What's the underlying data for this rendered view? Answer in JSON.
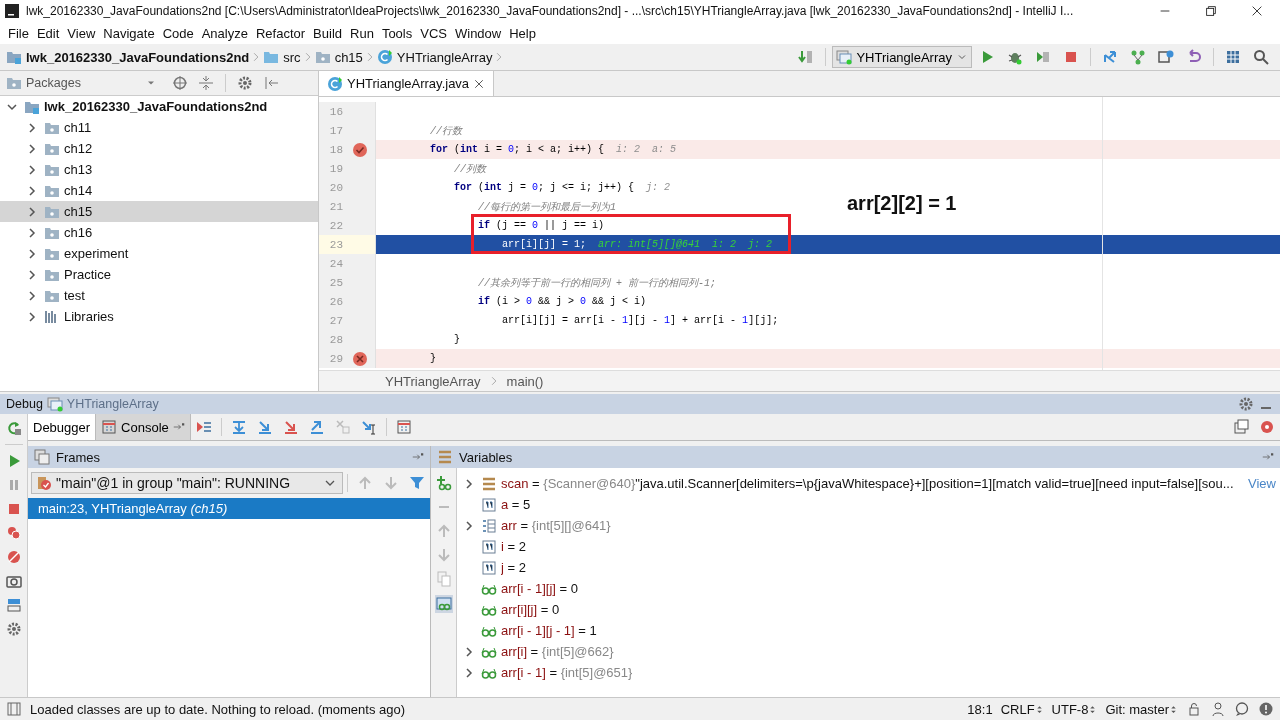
{
  "window": {
    "title": "lwk_20162330_JavaFoundations2nd [C:\\Users\\Administrator\\IdeaProjects\\lwk_20162330_JavaFoundations2nd] - ...\\src\\ch15\\YHTriangleArray.java [lwk_20162330_JavaFoundations2nd] - IntelliJ I..."
  },
  "menu": [
    "File",
    "Edit",
    "View",
    "Navigate",
    "Code",
    "Analyze",
    "Refactor",
    "Build",
    "Run",
    "Tools",
    "VCS",
    "Window",
    "Help"
  ],
  "breadcrumbs": [
    {
      "label": "lwk_20162330_JavaFoundations2nd",
      "kind": "project"
    },
    {
      "label": "src",
      "kind": "folder"
    },
    {
      "label": "ch15",
      "kind": "package"
    },
    {
      "label": "YHTriangleArray",
      "kind": "class"
    }
  ],
  "run_config": "YHTriangleArray",
  "project_panel": {
    "view": "Packages",
    "tree": [
      {
        "label": "lwk_20162330_JavaFoundations2nd",
        "kind": "module",
        "expanded": true,
        "selected": false,
        "children": [
          {
            "label": "ch11",
            "kind": "package",
            "expanded": false,
            "selected": false
          },
          {
            "label": "ch12",
            "kind": "package",
            "expanded": false,
            "selected": false
          },
          {
            "label": "ch13",
            "kind": "package",
            "expanded": false,
            "selected": false
          },
          {
            "label": "ch14",
            "kind": "package",
            "expanded": false,
            "selected": false
          },
          {
            "label": "ch15",
            "kind": "package",
            "expanded": false,
            "selected": true
          },
          {
            "label": "ch16",
            "kind": "package",
            "expanded": false,
            "selected": false
          },
          {
            "label": "experiment",
            "kind": "package",
            "expanded": false,
            "selected": false
          },
          {
            "label": "Practice",
            "kind": "package",
            "expanded": false,
            "selected": false
          },
          {
            "label": "test",
            "kind": "package",
            "expanded": false,
            "selected": false
          },
          {
            "label": "Libraries",
            "kind": "libraries",
            "expanded": false,
            "selected": false
          }
        ]
      }
    ]
  },
  "editor": {
    "tabs": [
      {
        "label": "YHTriangleArray.java",
        "selected": true
      }
    ],
    "lines": [
      {
        "number": "16",
        "kind": "plain",
        "current": false
      },
      {
        "number": "17",
        "kind": "plain",
        "current": false,
        "tokens": [
          {
            "t": "        //行数",
            "kind": "comment"
          }
        ]
      },
      {
        "number": "18",
        "kind": "breakpoint",
        "current": false,
        "tokens": [
          {
            "t": "        for",
            "kind": "keyword"
          },
          {
            "t": " (",
            "kind": "plain"
          },
          {
            "t": "int",
            "kind": "keyword"
          },
          {
            "t": " i = ",
            "kind": "plain"
          },
          {
            "t": "0",
            "kind": "number"
          },
          {
            "t": "; i < a; i++) {",
            "kind": "plain"
          },
          {
            "t": "  i: 2  a: 5",
            "kind": "hint"
          }
        ]
      },
      {
        "number": "19",
        "kind": "plain",
        "current": false,
        "tokens": [
          {
            "t": "            //列数",
            "kind": "comment"
          }
        ]
      },
      {
        "number": "20",
        "kind": "plain",
        "current": false,
        "tokens": [
          {
            "t": "            for",
            "kind": "keyword"
          },
          {
            "t": " (",
            "kind": "plain"
          },
          {
            "t": "int",
            "kind": "keyword"
          },
          {
            "t": " j = ",
            "kind": "plain"
          },
          {
            "t": "0",
            "kind": "number"
          },
          {
            "t": "; j <= i; j++) {",
            "kind": "plain"
          },
          {
            "t": "  j: 2",
            "kind": "hint"
          }
        ]
      },
      {
        "number": "21",
        "kind": "plain",
        "current": false,
        "tokens": [
          {
            "t": "                //每行的第一列和最后一列为1",
            "kind": "comment"
          }
        ]
      },
      {
        "number": "22",
        "kind": "plain",
        "current": false,
        "tokens": [
          {
            "t": "                if",
            "kind": "keyword"
          },
          {
            "t": " (j == ",
            "kind": "plain"
          },
          {
            "t": "0",
            "kind": "number"
          },
          {
            "t": " || j == i)",
            "kind": "plain"
          }
        ]
      },
      {
        "number": "23",
        "kind": "plain",
        "current": true,
        "tokens": [
          {
            "t": "                    arr[i][j] = 1;",
            "kind": "plain"
          },
          {
            "t": "  arr: int[5][]@641  i: 2  j: 2",
            "kind": "hint"
          }
        ]
      },
      {
        "number": "24",
        "kind": "plain",
        "current": false
      },
      {
        "number": "25",
        "kind": "plain",
        "current": false,
        "tokens": [
          {
            "t": "                //其余列等于前一行的相同列 + 前一行的相同列-1;",
            "kind": "comment"
          }
        ]
      },
      {
        "number": "26",
        "kind": "plain",
        "current": false,
        "tokens": [
          {
            "t": "                if",
            "kind": "keyword"
          },
          {
            "t": " (i > ",
            "kind": "plain"
          },
          {
            "t": "0",
            "kind": "number"
          },
          {
            "t": " && j > ",
            "kind": "plain"
          },
          {
            "t": "0",
            "kind": "number"
          },
          {
            "t": " && j < i)",
            "kind": "plain"
          }
        ]
      },
      {
        "number": "27",
        "kind": "plain",
        "current": false,
        "tokens": [
          {
            "t": "                    arr[i][j] = arr[i - ",
            "kind": "plain"
          },
          {
            "t": "1",
            "kind": "number"
          },
          {
            "t": "][j - ",
            "kind": "plain"
          },
          {
            "t": "1",
            "kind": "number"
          },
          {
            "t": "] + arr[i - ",
            "kind": "plain"
          },
          {
            "t": "1",
            "kind": "number"
          },
          {
            "t": "][j];",
            "kind": "plain"
          }
        ]
      },
      {
        "number": "28",
        "kind": "plain",
        "current": false,
        "tokens": [
          {
            "t": "            }",
            "kind": "plain"
          }
        ]
      },
      {
        "number": "29",
        "kind": "invalid_breakpoint",
        "current": false,
        "tokens": [
          {
            "t": "        }",
            "kind": "plain"
          }
        ]
      }
    ],
    "annotation": "arr[2][2] = 1",
    "breadcrumb": [
      "YHTriangleArray",
      "main()"
    ]
  },
  "debug": {
    "title": "Debug",
    "config": "YHTriangleArray",
    "tabs": [
      {
        "label": "Debugger",
        "selected": true
      },
      {
        "label": "Console",
        "selected": false
      }
    ],
    "frames": {
      "title": "Frames",
      "thread": "\"main\"@1 in group \"main\": RUNNING",
      "items": [
        {
          "text": "main:23, YHTriangleArray *(ch15)*",
          "selected": true
        }
      ]
    },
    "variables": {
      "title": "Variables",
      "items": [
        {
          "kind": "object",
          "expandable": true,
          "name": "scan",
          "sign": "=",
          "type": "{Scanner@640}",
          "value": "\"java.util.Scanner[delimiters=\\p{javaWhitespace}+][position=1][match valid=true][need input=false][sou...",
          "link": "View"
        },
        {
          "kind": "primitive",
          "expandable": false,
          "name": "a",
          "sign": "=",
          "value": "5"
        },
        {
          "kind": "array",
          "expandable": true,
          "name": "arr",
          "sign": "=",
          "type": "{int[5][]@641}"
        },
        {
          "kind": "primitive",
          "expandable": false,
          "name": "i",
          "sign": "=",
          "value": "2"
        },
        {
          "kind": "primitive",
          "expandable": false,
          "name": "j",
          "sign": "=",
          "value": "2"
        },
        {
          "kind": "watch",
          "expandable": false,
          "name": "arr[i - 1][j]",
          "sign": "=",
          "value": "0"
        },
        {
          "kind": "watch",
          "expandable": false,
          "name": "arr[i][j]",
          "sign": "=",
          "value": "0"
        },
        {
          "kind": "watch",
          "expandable": false,
          "name": "arr[i - 1][j - 1]",
          "sign": "=",
          "value": "1"
        },
        {
          "kind": "watch",
          "expandable": true,
          "name": "arr[i]",
          "sign": "=",
          "type": "{int[5]@662}"
        },
        {
          "kind": "watch",
          "expandable": true,
          "name": "arr[i - 1]",
          "sign": "=",
          "type": "{int[5]@651}"
        }
      ]
    }
  },
  "status_bar": {
    "message": "Loaded classes are up to date. Nothing to reload. (moments ago)",
    "position": "18:1",
    "line_separator": "CRLF",
    "encoding": "UTF-8",
    "vcs": "Git: master"
  }
}
